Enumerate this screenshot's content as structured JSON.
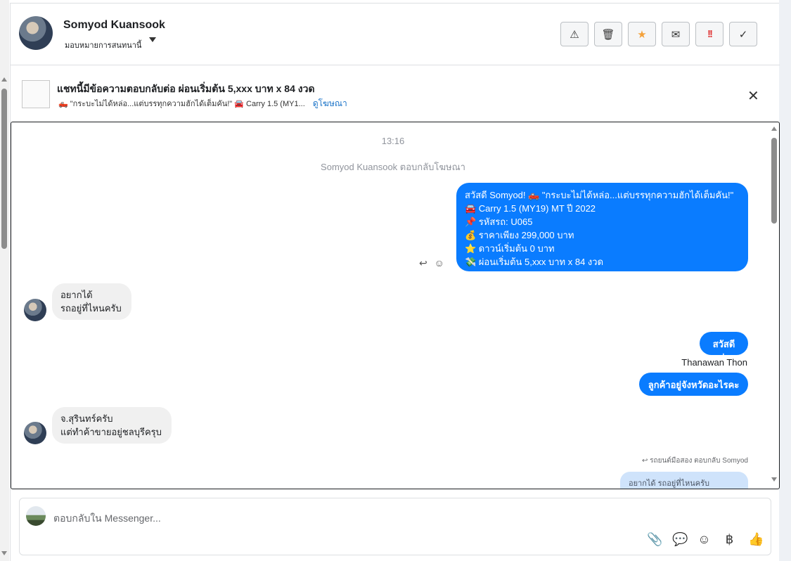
{
  "header": {
    "name": "Somyod Kuansook",
    "assign_label": "มอบหมายการสนทนานี้",
    "actions": [
      {
        "icon": "warning-icon",
        "glyph": "⚠"
      },
      {
        "icon": "trash-icon",
        "glyph": "🗑"
      },
      {
        "icon": "star-icon",
        "glyph": "★"
      },
      {
        "icon": "mail-icon",
        "glyph": "✉"
      },
      {
        "icon": "important-icon",
        "glyph": "!!"
      },
      {
        "icon": "check-icon",
        "glyph": "✓"
      }
    ]
  },
  "ad": {
    "title": "แชทนี้มีข้อความตอบกลับต่อ ผ่อนเริ่มต้น 5,xxx บาท x 84 งวด",
    "subtitle": "🛻 \"กระบะไม่ได้หล่อ...แต่บรรทุกความฮักได้เต็มคัน!\" 🚘 Carry 1.5 (MY1...",
    "link": "ดูโฆษณา",
    "close": "✕"
  },
  "chat": {
    "time": "13:16",
    "system_note": "Somyod Kuansook ตอบกลับโฆษณา",
    "ad_message_lines": [
      "สวัสดี Somyod! 🛻 \"กระบะไม่ได้หล่อ...แต่บรรทุกความฮักได้เต็มคัน!\"",
      "🚘 Carry 1.5 (MY19) MT ปี 2022",
      "📌 รหัสรถ: U065",
      "💰 ราคาเพียง 299,000 บาท",
      "⭐ ดาวน์เริ่มต้น 0 บาท",
      "💸 ผ่อนเริ่มต้น 5,xxx บาท x 84 งวด"
    ],
    "reply_icon": "↩",
    "emoji_icon": "☺",
    "incoming_1": [
      "อยากได้",
      "รถอยู่ที่ไหนครับ"
    ],
    "outgoing_2": "สวัสดีค่ะ",
    "sender_name": "Thanawan Thon",
    "outgoing_3": "ลูกค้าอยู่จังหวัดอะไรคะ",
    "incoming_2": [
      "จ.สุรินทร์ครับ",
      "แต่ทำค้าขายอยู่ชลบุรีครุบ"
    ],
    "reply_note": "รถยนต์มือสอง ตอบกลับ Somyod",
    "reply_quote": "อยากได้ รถอยู่ที่ไหนครับ"
  },
  "composer": {
    "placeholder": "ตอบกลับใน Messenger...",
    "tools": [
      {
        "icon": "attachment-icon",
        "glyph": "📎"
      },
      {
        "icon": "saved-reply-icon",
        "glyph": "💬"
      },
      {
        "icon": "emoji-icon",
        "glyph": "☺"
      },
      {
        "icon": "baht-icon",
        "glyph": "฿"
      },
      {
        "icon": "like-icon",
        "glyph": "👍"
      }
    ]
  }
}
